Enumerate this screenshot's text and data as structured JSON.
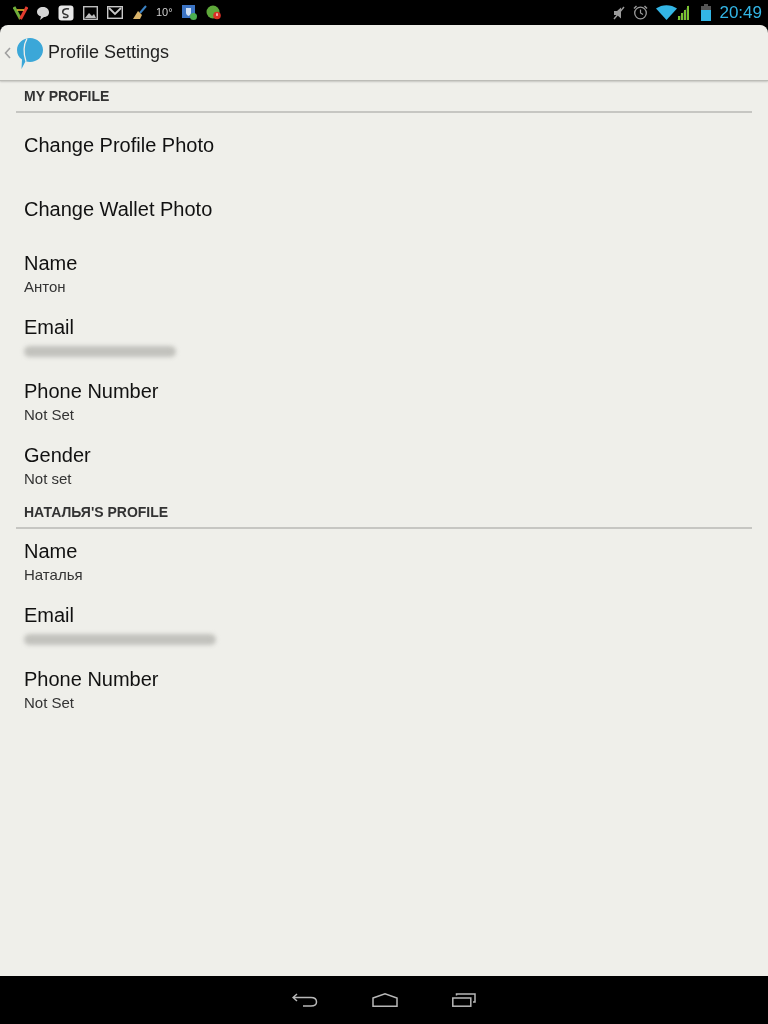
{
  "status_bar": {
    "weather_text": "10°",
    "time": "20:49"
  },
  "action_bar": {
    "title": "Profile Settings"
  },
  "sections": [
    {
      "header": "MY PROFILE",
      "items": [
        {
          "kind": "action",
          "title": "Change Profile Photo"
        },
        {
          "kind": "action",
          "title": "Change Wallet Photo"
        },
        {
          "kind": "field",
          "title": "Name",
          "value": "Антон"
        },
        {
          "kind": "redacted",
          "title": "Email"
        },
        {
          "kind": "field",
          "title": "Phone Number",
          "value": "Not Set"
        },
        {
          "kind": "field",
          "title": "Gender",
          "value": "Not set"
        }
      ]
    },
    {
      "header": "НАТАЛЬЯ'S PROFILE",
      "items": [
        {
          "kind": "field",
          "title": "Name",
          "value": "Наталья"
        },
        {
          "kind": "redacted",
          "title": "Email"
        },
        {
          "kind": "field",
          "title": "Phone Number",
          "value": "Not Set"
        }
      ]
    }
  ]
}
